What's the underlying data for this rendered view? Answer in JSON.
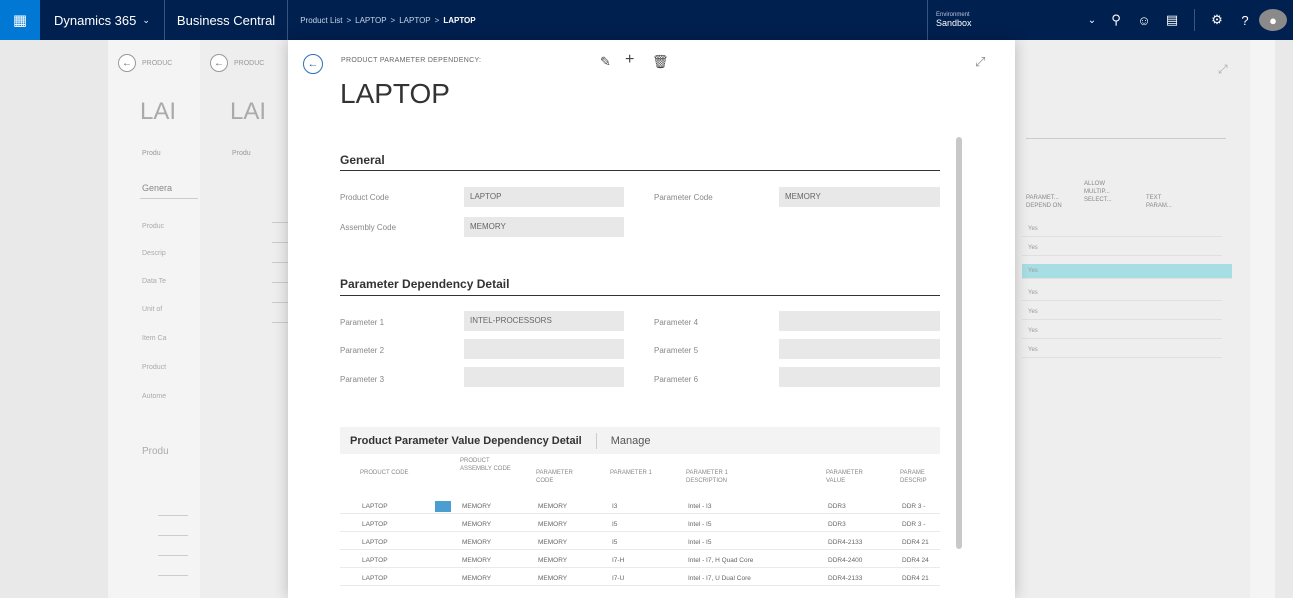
{
  "topbar": {
    "brand": "Dynamics 365",
    "app": "Business Central",
    "breadcrumbs": [
      "Product List",
      "LAPTOP",
      "LAPTOP",
      "LAPTOP"
    ],
    "environment_label": "Environment",
    "environment_value": "Sandbox"
  },
  "background": {
    "caption1": "PRODUC",
    "caption2": "PRODUC",
    "title1": "LAI",
    "title2": "LAI",
    "tab1": "Produ",
    "tab2": "Produ",
    "general": "Genera",
    "fields": [
      "Produc",
      "Descrip",
      "Data Te",
      "Unit of",
      "Item Ca",
      "Product",
      "Autome"
    ],
    "section": "Produ",
    "right_table": {
      "headers": [
        "PARAMET... DEPEND ON",
        "ALLOW MULTIP... SELECT...",
        "TEXT PARAM..."
      ],
      "rows": [
        "Yes",
        "Yes",
        "Yes",
        "Yes",
        "Yes",
        "Yes",
        "Yes"
      ]
    }
  },
  "dialog": {
    "caption": "PRODUCT PARAMETER DEPENDENCY:",
    "title": "LAPTOP",
    "general": {
      "header": "General",
      "product_code_label": "Product Code",
      "product_code": "LAPTOP",
      "assembly_code_label": "Assembly Code",
      "assembly_code": "MEMORY",
      "parameter_code_label": "Parameter Code",
      "parameter_code": "MEMORY"
    },
    "detail": {
      "header": "Parameter Dependency Detail",
      "p1_label": "Parameter 1",
      "p1": "INTEL-PROCESSORS",
      "p2_label": "Parameter 2",
      "p2": "",
      "p3_label": "Parameter 3",
      "p3": "",
      "p4_label": "Parameter 4",
      "p4": "",
      "p5_label": "Parameter 5",
      "p5": "",
      "p6_label": "Parameter 6",
      "p6": ""
    },
    "subpage": {
      "title": "Product Parameter Value Dependency Detail",
      "manage": "Manage",
      "columns": [
        "PRODUCT CODE",
        "PRODUCT ASSEMBLY CODE",
        "PARAMETER CODE",
        "PARAMETER 1",
        "PARAMETER 1 DESCRIPTION",
        "PARAMETER VALUE",
        "PARAME DESCRIP"
      ],
      "rows": [
        [
          "LAPTOP",
          "MEMORY",
          "MEMORY",
          "I3",
          "Intel - I3",
          "DDR3",
          "DDR 3 -"
        ],
        [
          "LAPTOP",
          "MEMORY",
          "MEMORY",
          "I5",
          "Intel - I5",
          "DDR3",
          "DDR 3 -"
        ],
        [
          "LAPTOP",
          "MEMORY",
          "MEMORY",
          "I5",
          "Intel - I5",
          "DDR4-2133",
          "DDR4 21"
        ],
        [
          "LAPTOP",
          "MEMORY",
          "MEMORY",
          "I7-H",
          "Intel - I7, H Quad Core",
          "DDR4-2400",
          "DDR4 24"
        ],
        [
          "LAPTOP",
          "MEMORY",
          "MEMORY",
          "I7-U",
          "Intel - I7, U Dual Core",
          "DDR4-2133",
          "DDR4 21"
        ]
      ]
    }
  },
  "colors": {
    "topbar": "#002050",
    "waffle": "#0078d4",
    "selection": "#a7dee3",
    "row_selector": "#4a9fd0"
  },
  "icons": [
    "waffle-icon",
    "chevron-down-icon",
    "lightbulb-icon",
    "smiley-icon",
    "book-icon",
    "gear-icon",
    "help-icon",
    "user-icon",
    "back-arrow-icon",
    "edit-icon",
    "add-icon",
    "delete-icon",
    "expand-icon"
  ]
}
